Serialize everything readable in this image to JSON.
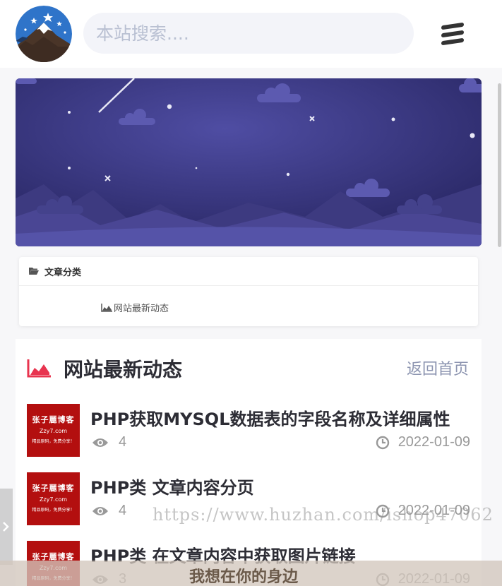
{
  "header": {
    "logo_icon": "mountain-logo-icon",
    "search_placeholder": "本站搜索....",
    "menu_icon": "hamburger-menu-icon"
  },
  "banner": {
    "description_icon": "night-sky-banner"
  },
  "category": {
    "title": "文章分类",
    "title_icon": "folder-open-icon",
    "link_label": "网站最新动态",
    "link_icon": "area-chart-icon"
  },
  "list": {
    "title": "网站最新动态",
    "title_icon": "area-chart-icon",
    "title_icon_color": "#e8344f",
    "back_label": "返回首页",
    "thumb_name": "张子麗博客",
    "thumb_domain": "Zzy7.com",
    "thumb_slogan": "精品原码，免费分享！",
    "posts": [
      {
        "title": "PHP获取MYSQL数据表的字段名称及详细属性",
        "views": "4",
        "date": "2022-01-09"
      },
      {
        "title": "PHP类 文章内容分页",
        "views": "4",
        "date": "2022-01-09"
      },
      {
        "title": "PHP类 在文章内容中获取图片链接",
        "views": "3",
        "date": "2022-01-09"
      }
    ]
  },
  "watermark": "https://www.huzhan.com/ishop47062",
  "music_bar": {
    "text": "我想在你的身边"
  },
  "colors": {
    "accent_red": "#e8344f",
    "banner_purple": "#3f3d85",
    "thumb_red": "#b30f0f"
  }
}
